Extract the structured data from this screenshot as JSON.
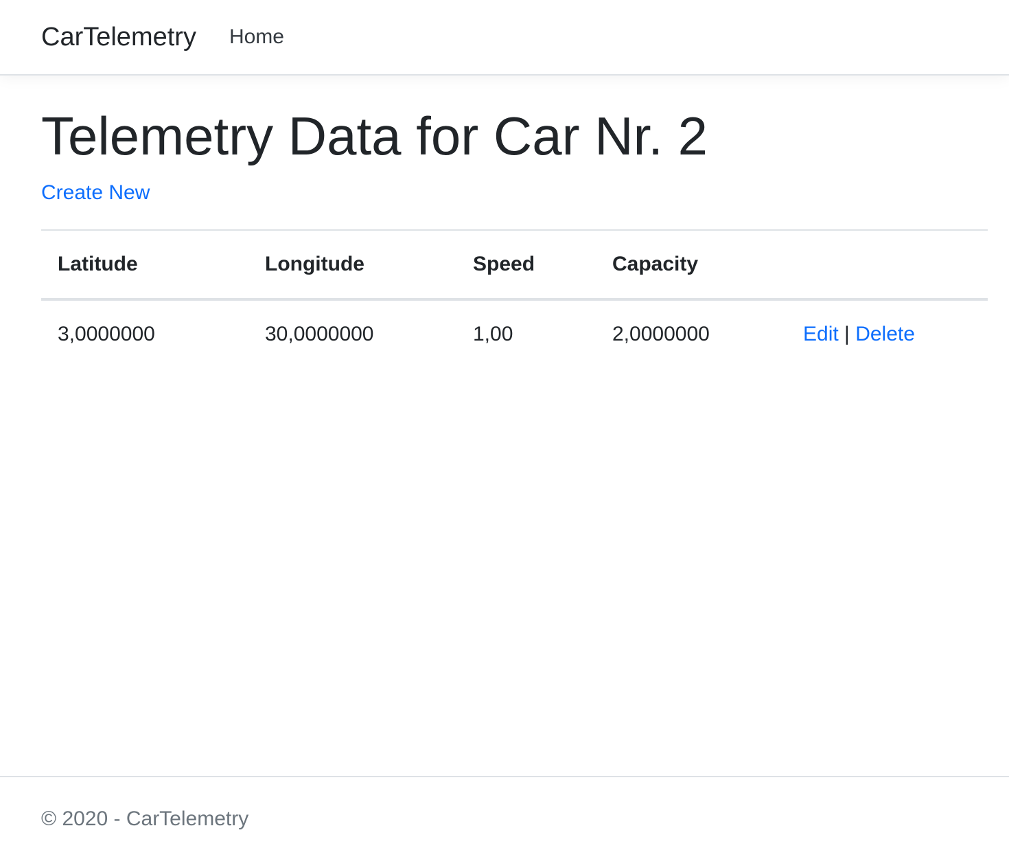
{
  "nav": {
    "brand": "CarTelemetry",
    "home": "Home"
  },
  "main": {
    "title": "Telemetry Data for Car Nr. 2",
    "create_new": "Create New",
    "table": {
      "headers": [
        "Latitude",
        "Longitude",
        "Speed",
        "Capacity"
      ],
      "rows": [
        {
          "cells": [
            "3,0000000",
            "30,0000000",
            "1,00",
            "2,0000000"
          ],
          "edit": "Edit",
          "sep": "|",
          "delete": "Delete"
        }
      ]
    }
  },
  "footer": {
    "text": "© 2020 - CarTelemetry"
  }
}
